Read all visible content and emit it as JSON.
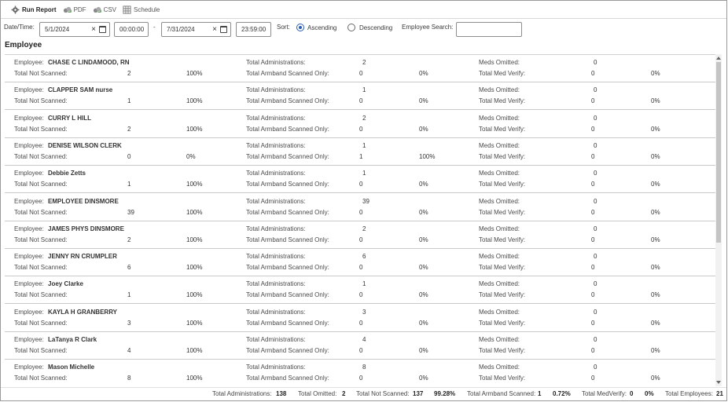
{
  "toolbar": {
    "run_report": "Run Report",
    "pdf": "PDF",
    "csv": "CSV",
    "schedule": "Schedule"
  },
  "filters": {
    "datetime_label": "Date/Time:",
    "start_date": "5/1/2024",
    "start_time": "00:00:00",
    "range_sep": "-",
    "end_date": "7/31/2024",
    "end_time": "23:59:00",
    "sort_label": "Sort:",
    "ascending": "Ascending",
    "descending": "Descending",
    "sort_selected": "Ascending",
    "search_label": "Employee Search:",
    "search_value": ""
  },
  "section_title": "Employee",
  "labels": {
    "employee": "Employee:",
    "total_not_scanned": "Total Not Scanned:",
    "total_administrations": "Total Administrations:",
    "total_armband_scanned_only": "Total Armband Scanned Only:",
    "meds_omitted": "Meds Omitted:",
    "total_med_verify": "Total Med Verify:"
  },
  "employees": [
    {
      "name": "CHASE C LINDAMOOD, RN",
      "not_scanned": "2",
      "not_scanned_pct": "100%",
      "administrations": "2",
      "armband": "0",
      "armband_pct": "0%",
      "omitted": "0",
      "med_verify": "0",
      "med_verify_pct": "0%"
    },
    {
      "name": "CLAPPER SAM nurse",
      "not_scanned": "1",
      "not_scanned_pct": "100%",
      "administrations": "1",
      "armband": "0",
      "armband_pct": "0%",
      "omitted": "0",
      "med_verify": "0",
      "med_verify_pct": "0%"
    },
    {
      "name": "CURRY L HILL",
      "not_scanned": "2",
      "not_scanned_pct": "100%",
      "administrations": "2",
      "armband": "0",
      "armband_pct": "0%",
      "omitted": "0",
      "med_verify": "0",
      "med_verify_pct": "0%"
    },
    {
      "name": "DENISE WILSON CLERK",
      "not_scanned": "0",
      "not_scanned_pct": "0%",
      "administrations": "1",
      "armband": "1",
      "armband_pct": "100%",
      "omitted": "0",
      "med_verify": "0",
      "med_verify_pct": "0%"
    },
    {
      "name": "Debbie Zetts",
      "not_scanned": "1",
      "not_scanned_pct": "100%",
      "administrations": "1",
      "armband": "0",
      "armband_pct": "0%",
      "omitted": "0",
      "med_verify": "0",
      "med_verify_pct": "0%"
    },
    {
      "name": "EMPLOYEE DINSMORE",
      "not_scanned": "39",
      "not_scanned_pct": "100%",
      "administrations": "39",
      "armband": "0",
      "armband_pct": "0%",
      "omitted": "0",
      "med_verify": "0",
      "med_verify_pct": "0%"
    },
    {
      "name": "JAMES PHYS DINSMORE",
      "not_scanned": "2",
      "not_scanned_pct": "100%",
      "administrations": "2",
      "armband": "0",
      "armband_pct": "0%",
      "omitted": "0",
      "med_verify": "0",
      "med_verify_pct": "0%"
    },
    {
      "name": "JENNY RN CRUMPLER",
      "not_scanned": "6",
      "not_scanned_pct": "100%",
      "administrations": "6",
      "armband": "0",
      "armband_pct": "0%",
      "omitted": "0",
      "med_verify": "0",
      "med_verify_pct": "0%"
    },
    {
      "name": "Joey Clarke",
      "not_scanned": "1",
      "not_scanned_pct": "100%",
      "administrations": "1",
      "armband": "0",
      "armband_pct": "0%",
      "omitted": "0",
      "med_verify": "0",
      "med_verify_pct": "0%"
    },
    {
      "name": "KAYLA H GRANBERRY",
      "not_scanned": "3",
      "not_scanned_pct": "100%",
      "administrations": "3",
      "armband": "0",
      "armband_pct": "0%",
      "omitted": "0",
      "med_verify": "0",
      "med_verify_pct": "0%"
    },
    {
      "name": "LaTanya R Clark",
      "not_scanned": "4",
      "not_scanned_pct": "100%",
      "administrations": "4",
      "armband": "0",
      "armband_pct": "0%",
      "omitted": "0",
      "med_verify": "0",
      "med_verify_pct": "0%"
    },
    {
      "name": "Mason Michelle",
      "not_scanned": "8",
      "not_scanned_pct": "100%",
      "administrations": "8",
      "armband": "0",
      "armband_pct": "0%",
      "omitted": "0",
      "med_verify": "0",
      "med_verify_pct": "0%"
    }
  ],
  "totals": {
    "administrations_label": "Total Administrations:",
    "administrations": "138",
    "omitted_label": "Total Omitted:",
    "omitted": "2",
    "not_scanned_label": "Total Not Scanned:",
    "not_scanned": "137",
    "not_scanned_pct": "99.28%",
    "armband_label": "Total Armband Scanned:",
    "armband": "1",
    "armband_pct": "0.72%",
    "med_verify_label": "Total MedVerify:",
    "med_verify": "0",
    "med_verify_pct": "0%",
    "employees_label": "Total Employees:",
    "employees": "21"
  },
  "colors": {
    "accent": "#2a5db0",
    "divider": "#c9c9c9"
  }
}
